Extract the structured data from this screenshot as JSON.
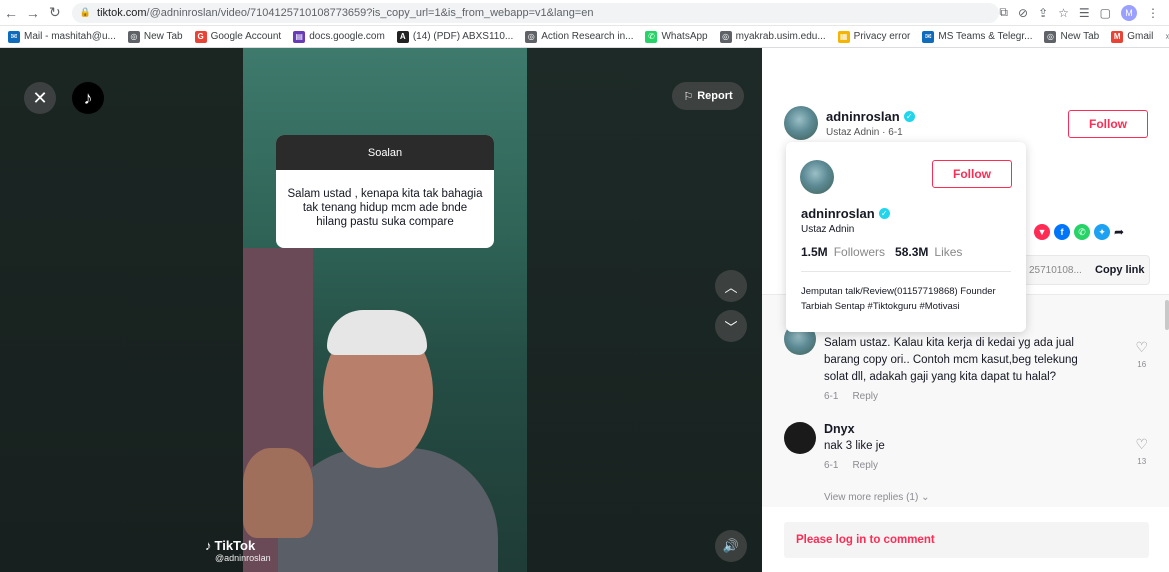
{
  "browser": {
    "url_domain": "tiktok.com",
    "url_path": "/@adninroslan/video/7104125710108773659?is_copy_url=1&is_from_webapp=v1&lang=en",
    "profile_initial": "M",
    "bookmarks": [
      {
        "label": "Mail - mashitah@u...",
        "color": "#0f6cbd",
        "glyph": "✉"
      },
      {
        "label": "New Tab",
        "color": "#5f6368",
        "glyph": "◎"
      },
      {
        "label": "Google Account",
        "color": "#ea4335",
        "glyph": "G"
      },
      {
        "label": "docs.google.com",
        "color": "#673ab7",
        "glyph": "▤"
      },
      {
        "label": "(14) (PDF) ABXS110...",
        "color": "#222222",
        "glyph": "A"
      },
      {
        "label": "Action Research in...",
        "color": "#5f6368",
        "glyph": "◎"
      },
      {
        "label": "WhatsApp",
        "color": "#25d366",
        "glyph": "✆"
      },
      {
        "label": "myakrab.usim.edu...",
        "color": "#5f6368",
        "glyph": "◎"
      },
      {
        "label": "Privacy error",
        "color": "#f4b400",
        "glyph": "▦"
      },
      {
        "label": "MS Teams & Telegr...",
        "color": "#0f6cbd",
        "glyph": "✉"
      },
      {
        "label": "New Tab",
        "color": "#5f6368",
        "glyph": "◎"
      },
      {
        "label": "Gmail",
        "color": "#ea4335",
        "glyph": "M"
      }
    ],
    "bookmarks_more": "»"
  },
  "video": {
    "report_label": "Report",
    "question_title": "Soalan",
    "question_text": "Salam ustad , kenapa kita tak bahagia tak tenang hidup mcm ade bnde hilang pastu suka compare",
    "watermark_brand": "TikTok",
    "watermark_handle": "@adninroslan"
  },
  "author": {
    "username": "adninroslan",
    "subline": "Ustaz Adnin · 6-1",
    "follow_label": "Follow"
  },
  "share": {
    "icons": [
      {
        "name": "embed-icon",
        "color": "#fe2c55",
        "glyph": "▼"
      },
      {
        "name": "facebook-icon",
        "color": "#0075fa",
        "glyph": "f"
      },
      {
        "name": "whatsapp-icon",
        "color": "#25d366",
        "glyph": "✆"
      },
      {
        "name": "twitter-icon",
        "color": "#1da1f2",
        "glyph": "✦"
      }
    ],
    "more_glyph": "➦",
    "url_snippet": "25710108...",
    "copy_label": "Copy link"
  },
  "popover": {
    "follow_label": "Follow",
    "username": "adninroslan",
    "nickname": "Ustaz Adnin",
    "followers_count": "1.5M",
    "followers_label": "Followers",
    "likes_count": "58.3M",
    "likes_label": "Likes",
    "bio": "Jemputan talk/Review(01157719868) Founder Tarbiah Sentap #Tiktokguru #Motivasi"
  },
  "comments": [
    {
      "text": "Salam ustaz. Kalau kita kerja di kedai yg ada jual barang copy ori.. Contoh mcm kasut,beg telekung solat dll, adakah gaji yang kita dapat tu halal?",
      "date": "6-1",
      "reply": "Reply",
      "likes": "16"
    },
    {
      "user": "Dnyx",
      "text": "nak 3 like je",
      "date": "6-1",
      "reply": "Reply",
      "likes": "13"
    }
  ],
  "view_more": "View more replies (1) ⌄",
  "login_prompt": "Please log in to comment",
  "colors": {
    "accent": "#fe2c55",
    "verified": "#20d5ec"
  }
}
